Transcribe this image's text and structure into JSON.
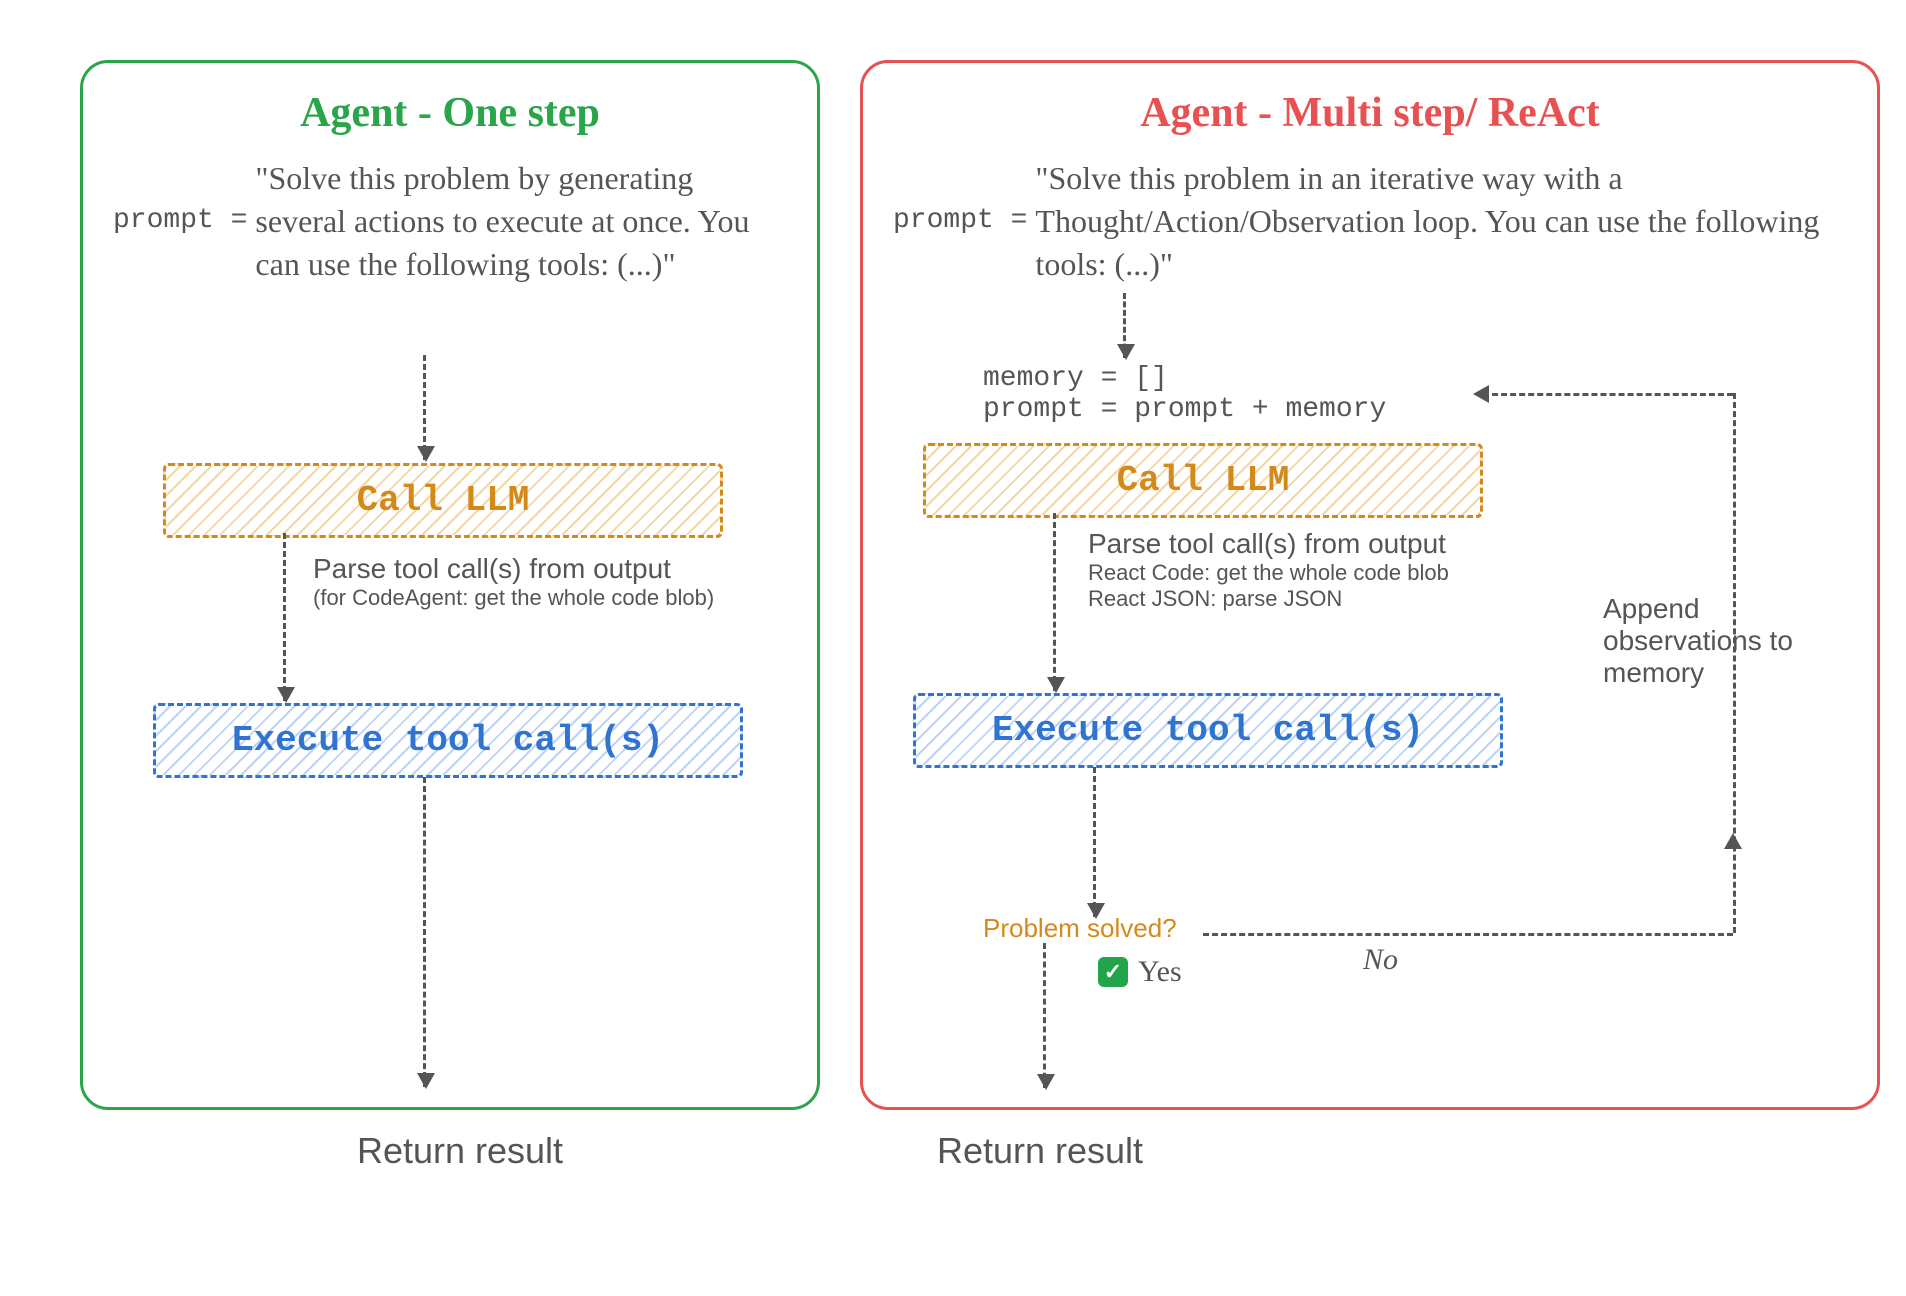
{
  "left": {
    "title": "Agent - One step",
    "prompt_lhs": "prompt =",
    "prompt_body": "\"Solve this problem by generating several actions to execute at once. You can use the following tools: (...)\"",
    "call_llm": "Call LLM",
    "parse1": "Parse tool call(s) from output",
    "parse2": "(for CodeAgent: get the whole code blob)",
    "execute": "Execute tool call(s)",
    "return": "Return result"
  },
  "right": {
    "title": "Agent - Multi step/ ReAct",
    "prompt_lhs": "prompt =",
    "prompt_body": "\"Solve this problem in an iterative way with a Thought/Action/Observation loop. You can use the following tools: (...)\"",
    "mem1": "memory = []",
    "mem2": "prompt = prompt + memory",
    "call_llm": "Call LLM",
    "parse1": "Parse tool call(s) from output",
    "parse2": "React Code: get the whole code blob",
    "parse3": "React JSON: parse JSON",
    "execute": "Execute tool call(s)",
    "decision": "Problem solved?",
    "yes": "Yes",
    "no": "No",
    "append": "Append observations to memory",
    "return": "Return result"
  },
  "chart_data": {
    "type": "flowchart",
    "panels": [
      {
        "name": "Agent - One step",
        "border_color": "#2aa54a",
        "nodes": [
          {
            "id": "prompt",
            "kind": "text",
            "text": "prompt = \"Solve this problem by generating several actions to execute at once. You can use the following tools: (...)\""
          },
          {
            "id": "call_llm",
            "kind": "process",
            "text": "Call LLM",
            "color": "#d48a1a"
          },
          {
            "id": "parse",
            "kind": "annotation",
            "text": "Parse tool call(s) from output (for CodeAgent: get the whole code blob)"
          },
          {
            "id": "exec",
            "kind": "process",
            "text": "Execute tool call(s)",
            "color": "#2f74d0"
          },
          {
            "id": "return",
            "kind": "terminal",
            "text": "Return result"
          }
        ],
        "edges": [
          {
            "from": "prompt",
            "to": "call_llm"
          },
          {
            "from": "call_llm",
            "to": "exec",
            "label": "parse"
          },
          {
            "from": "exec",
            "to": "return"
          }
        ]
      },
      {
        "name": "Agent - Multi step/ ReAct",
        "border_color": "#e85151",
        "nodes": [
          {
            "id": "prompt",
            "kind": "text",
            "text": "prompt = \"Solve this problem in an iterative way with a Thought/Action/Observation loop. You can use the following tools: (...)\""
          },
          {
            "id": "mem",
            "kind": "text",
            "text": "memory = [] ; prompt = prompt + memory"
          },
          {
            "id": "call_llm",
            "kind": "process",
            "text": "Call LLM",
            "color": "#d48a1a"
          },
          {
            "id": "parse",
            "kind": "annotation",
            "text": "Parse tool call(s) from output; React Code: get the whole code blob; React JSON: parse JSON"
          },
          {
            "id": "exec",
            "kind": "process",
            "text": "Execute tool call(s)",
            "color": "#2f74d0"
          },
          {
            "id": "decision",
            "kind": "decision",
            "text": "Problem solved?"
          },
          {
            "id": "return",
            "kind": "terminal",
            "text": "Return result"
          }
        ],
        "edges": [
          {
            "from": "prompt",
            "to": "mem"
          },
          {
            "from": "mem",
            "to": "call_llm"
          },
          {
            "from": "call_llm",
            "to": "exec",
            "label": "parse"
          },
          {
            "from": "exec",
            "to": "decision"
          },
          {
            "from": "decision",
            "to": "return",
            "label": "Yes"
          },
          {
            "from": "decision",
            "to": "mem",
            "label": "No — Append observations to memory",
            "loop": true
          }
        ]
      }
    ]
  }
}
